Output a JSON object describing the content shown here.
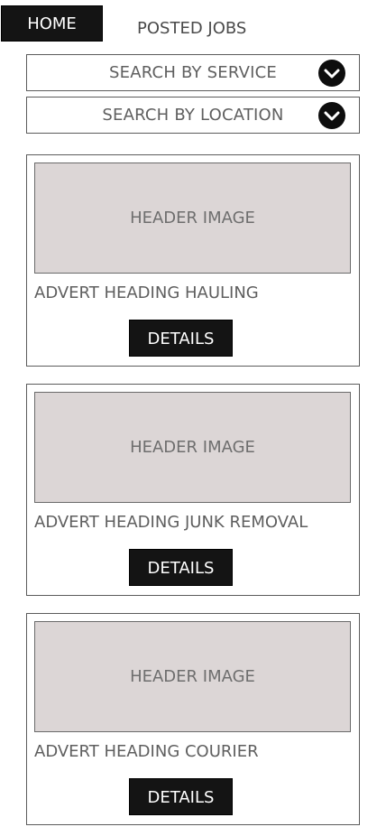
{
  "nav": {
    "home_label": "HOME",
    "posted_jobs_label": "POSTED JOBS"
  },
  "filters": {
    "service_label": "SEARCH BY SERVICE",
    "location_label": "SEARCH BY LOCATION",
    "dropdown_icon": "chevron-down-icon"
  },
  "adverts": [
    {
      "image_label": "HEADER IMAGE",
      "heading": "ADVERT HEADING HAULING",
      "button_label": "DETAILS"
    },
    {
      "image_label": "HEADER IMAGE",
      "heading": "ADVERT HEADING JUNK REMOVAL",
      "button_label": "DETAILS"
    },
    {
      "image_label": "HEADER IMAGE",
      "heading": "ADVERT HEADING COURIER",
      "button_label": "DETAILS"
    }
  ],
  "colors": {
    "dark": "#141414",
    "image_placeholder": "#dcd6d6",
    "text_gray": "#5f5f5f"
  }
}
